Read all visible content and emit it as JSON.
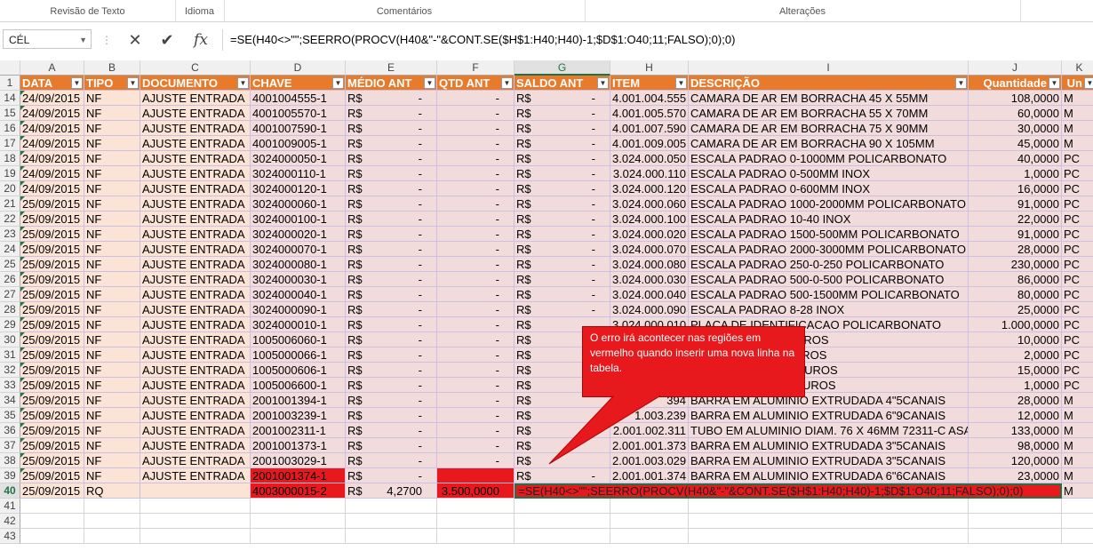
{
  "ribbon": {
    "groups": [
      "Revisão de Texto",
      "Idioma",
      "Comentários",
      "Alterações"
    ]
  },
  "formula_bar": {
    "name_box": "CÉL",
    "formula": "=SE(H40<>\"\";SEERRO(PROCV(H40&\"-\"&CONT.SE($H$1:H40;H40)-1;$D$1:O40;11;FALSO);0);0)",
    "icons": [
      "cancel-x-icon",
      "enter-check-icon",
      "insert-function-fx-icon"
    ],
    "fx_label": "fx"
  },
  "columns": [
    "A",
    "B",
    "C",
    "D",
    "E",
    "F",
    "G",
    "H",
    "I",
    "J",
    "K"
  ],
  "header_row": {
    "row": "1",
    "cells": [
      "DATA",
      "TIPO",
      "DOCUMENTO",
      "CHAVE",
      "MÉDIO ANT",
      "QTD ANT",
      "SALDO ANT",
      "ITEM",
      "DESCRIÇÃO",
      "Quantidade",
      "Un"
    ]
  },
  "rows": [
    {
      "num": "14",
      "data": "24/09/2015",
      "tipo": "NF",
      "doc": "AJUSTE ENTRADA",
      "chave": "4001004555-1",
      "medio": "R$",
      "medio_v": "-",
      "qtd": "-",
      "saldo": "R$",
      "saldo_v": "-",
      "item": "4.001.004.555",
      "desc": "CAMARA DE AR EM BORRACHA 45 X 55MM",
      "quant": "108,0000",
      "un": "M"
    },
    {
      "num": "15",
      "data": "24/09/2015",
      "tipo": "NF",
      "doc": "AJUSTE ENTRADA",
      "chave": "4001005570-1",
      "medio": "R$",
      "medio_v": "-",
      "qtd": "-",
      "saldo": "R$",
      "saldo_v": "-",
      "item": "4.001.005.570",
      "desc": "CAMARA DE AR EM BORRACHA 55 X 70MM",
      "quant": "60,0000",
      "un": "M"
    },
    {
      "num": "16",
      "data": "24/09/2015",
      "tipo": "NF",
      "doc": "AJUSTE ENTRADA",
      "chave": "4001007590-1",
      "medio": "R$",
      "medio_v": "-",
      "qtd": "-",
      "saldo": "R$",
      "saldo_v": "-",
      "item": "4.001.007.590",
      "desc": "CAMARA DE AR EM BORRACHA 75 X 90MM",
      "quant": "30,0000",
      "un": "M"
    },
    {
      "num": "17",
      "data": "24/09/2015",
      "tipo": "NF",
      "doc": "AJUSTE ENTRADA",
      "chave": "4001009005-1",
      "medio": "R$",
      "medio_v": "-",
      "qtd": "-",
      "saldo": "R$",
      "saldo_v": "-",
      "item": "4.001.009.005",
      "desc": "CAMARA DE AR EM BORRACHA 90 X 105MM",
      "quant": "45,0000",
      "un": "M"
    },
    {
      "num": "18",
      "data": "24/09/2015",
      "tipo": "NF",
      "doc": "AJUSTE ENTRADA",
      "chave": "3024000050-1",
      "medio": "R$",
      "medio_v": "-",
      "qtd": "-",
      "saldo": "R$",
      "saldo_v": "-",
      "item": "3.024.000.050",
      "desc": "ESCALA PADRAO 0-1000MM POLICARBONATO",
      "quant": "40,0000",
      "un": "PC"
    },
    {
      "num": "19",
      "data": "24/09/2015",
      "tipo": "NF",
      "doc": "AJUSTE ENTRADA",
      "chave": "3024000110-1",
      "medio": "R$",
      "medio_v": "-",
      "qtd": "-",
      "saldo": "R$",
      "saldo_v": "-",
      "item": "3.024.000.110",
      "desc": "ESCALA PADRAO 0-500MM INOX",
      "quant": "1,0000",
      "un": "PC"
    },
    {
      "num": "20",
      "data": "24/09/2015",
      "tipo": "NF",
      "doc": "AJUSTE ENTRADA",
      "chave": "3024000120-1",
      "medio": "R$",
      "medio_v": "-",
      "qtd": "-",
      "saldo": "R$",
      "saldo_v": "-",
      "item": "3.024.000.120",
      "desc": "ESCALA PADRAO 0-600MM INOX",
      "quant": "16,0000",
      "un": "PC"
    },
    {
      "num": "21",
      "data": "25/09/2015",
      "tipo": "NF",
      "doc": "AJUSTE ENTRADA",
      "chave": "3024000060-1",
      "medio": "R$",
      "medio_v": "-",
      "qtd": "-",
      "saldo": "R$",
      "saldo_v": "-",
      "item": "3.024.000.060",
      "desc": "ESCALA PADRAO 1000-2000MM POLICARBONATO",
      "quant": "91,0000",
      "un": "PC"
    },
    {
      "num": "22",
      "data": "25/09/2015",
      "tipo": "NF",
      "doc": "AJUSTE ENTRADA",
      "chave": "3024000100-1",
      "medio": "R$",
      "medio_v": "-",
      "qtd": "-",
      "saldo": "R$",
      "saldo_v": "-",
      "item": "3.024.000.100",
      "desc": "ESCALA PADRAO 10-40 INOX",
      "quant": "22,0000",
      "un": "PC"
    },
    {
      "num": "23",
      "data": "25/09/2015",
      "tipo": "NF",
      "doc": "AJUSTE ENTRADA",
      "chave": "3024000020-1",
      "medio": "R$",
      "medio_v": "-",
      "qtd": "-",
      "saldo": "R$",
      "saldo_v": "-",
      "item": "3.024.000.020",
      "desc": "ESCALA PADRAO 1500-500MM POLICARBONATO",
      "quant": "91,0000",
      "un": "PC"
    },
    {
      "num": "24",
      "data": "25/09/2015",
      "tipo": "NF",
      "doc": "AJUSTE ENTRADA",
      "chave": "3024000070-1",
      "medio": "R$",
      "medio_v": "-",
      "qtd": "-",
      "saldo": "R$",
      "saldo_v": "-",
      "item": "3.024.000.070",
      "desc": "ESCALA PADRAO 2000-3000MM POLICARBONATO",
      "quant": "28,0000",
      "un": "PC"
    },
    {
      "num": "25",
      "data": "25/09/2015",
      "tipo": "NF",
      "doc": "AJUSTE ENTRADA",
      "chave": "3024000080-1",
      "medio": "R$",
      "medio_v": "-",
      "qtd": "-",
      "saldo": "R$",
      "saldo_v": "-",
      "item": "3.024.000.080",
      "desc": "ESCALA PADRAO 250-0-250 POLICARBONATO",
      "quant": "230,0000",
      "un": "PC"
    },
    {
      "num": "26",
      "data": "25/09/2015",
      "tipo": "NF",
      "doc": "AJUSTE ENTRADA",
      "chave": "3024000030-1",
      "medio": "R$",
      "medio_v": "-",
      "qtd": "-",
      "saldo": "R$",
      "saldo_v": "-",
      "item": "3.024.000.030",
      "desc": "ESCALA PADRAO 500-0-500 POLICARBONATO",
      "quant": "86,0000",
      "un": "PC"
    },
    {
      "num": "27",
      "data": "25/09/2015",
      "tipo": "NF",
      "doc": "AJUSTE ENTRADA",
      "chave": "3024000040-1",
      "medio": "R$",
      "medio_v": "-",
      "qtd": "-",
      "saldo": "R$",
      "saldo_v": "-",
      "item": "3.024.000.040",
      "desc": "ESCALA PADRAO 500-1500MM POLICARBONATO",
      "quant": "80,0000",
      "un": "PC"
    },
    {
      "num": "28",
      "data": "25/09/2015",
      "tipo": "NF",
      "doc": "AJUSTE ENTRADA",
      "chave": "3024000090-1",
      "medio": "R$",
      "medio_v": "-",
      "qtd": "-",
      "saldo": "R$",
      "saldo_v": "-",
      "item": "3.024.000.090",
      "desc": "ESCALA PADRAO 8-28 INOX",
      "quant": "25,0000",
      "un": "PC"
    },
    {
      "num": "29",
      "data": "25/09/2015",
      "tipo": "NF",
      "doc": "AJUSTE ENTRADA",
      "chave": "3024000010-1",
      "medio": "R$",
      "medio_v": "-",
      "qtd": "-",
      "saldo": "R$",
      "saldo_v": "",
      "item": "3.024.000.010",
      "desc": "PLACA DE IDENTIFICACAO POLICARBONATO",
      "quant": "1.000,0000",
      "un": "PC"
    },
    {
      "num": "30",
      "data": "25/09/2015",
      "tipo": "NF",
      "doc": "AJUSTE ENTRADA",
      "chave": "1005006060-1",
      "medio": "R$",
      "medio_v": "-",
      "qtd": "-",
      "saldo": "R$",
      "saldo_v": "",
      "item": "",
      "desc": "TEIRA 6\" LB COM FUROS",
      "quant": "10,0000",
      "un": "PC"
    },
    {
      "num": "31",
      "data": "25/09/2015",
      "tipo": "NF",
      "doc": "AJUSTE ENTRADA",
      "chave": "1005000066-1",
      "medio": "R$",
      "medio_v": "-",
      "qtd": "-",
      "saldo": "R$",
      "saldo_v": "",
      "item": "",
      "desc": "TEIRA 6\" LB SEM FUROS",
      "quant": "2,0000",
      "un": "PC"
    },
    {
      "num": "32",
      "data": "25/09/2015",
      "tipo": "NF",
      "doc": "AJUSTE ENTRADA",
      "chave": "1005000606-1",
      "medio": "R$",
      "medio_v": "-",
      "qtd": "-",
      "saldo": "R$",
      "saldo_v": "",
      "item": "",
      "desc": "TEIRA 6\" LOB COM FUROS",
      "quant": "15,0000",
      "un": "PC"
    },
    {
      "num": "33",
      "data": "25/09/2015",
      "tipo": "NF",
      "doc": "AJUSTE ENTRADA",
      "chave": "1005006600-1",
      "medio": "R$",
      "medio_v": "-",
      "qtd": "-",
      "saldo": "R$",
      "saldo_v": "",
      "item": "",
      "desc": "TEIRA 6\" LOB SEM FUROS",
      "quant": "1,0000",
      "un": "PC"
    },
    {
      "num": "34",
      "data": "25/09/2015",
      "tipo": "NF",
      "doc": "AJUSTE ENTRADA",
      "chave": "2001001394-1",
      "medio": "R$",
      "medio_v": "-",
      "qtd": "-",
      "saldo": "R$",
      "saldo_v": "",
      "item": "394",
      "desc": "BARRA EM ALUMINIO EXTRUDADA 4\"5CANAIS",
      "quant": "28,0000",
      "un": "M"
    },
    {
      "num": "35",
      "data": "25/09/2015",
      "tipo": "NF",
      "doc": "AJUSTE ENTRADA",
      "chave": "2001003239-1",
      "medio": "R$",
      "medio_v": "-",
      "qtd": "-",
      "saldo": "R$",
      "saldo_v": "",
      "item": "1.003.239",
      "desc": "BARRA EM ALUMINIO EXTRUDADA 6\"9CANAIS",
      "quant": "12,0000",
      "un": "M"
    },
    {
      "num": "36",
      "data": "25/09/2015",
      "tipo": "NF",
      "doc": "AJUSTE ENTRADA",
      "chave": "2001002311-1",
      "medio": "R$",
      "medio_v": "-",
      "qtd": "-",
      "saldo": "R$",
      "saldo_v": "",
      "item": "2.001.002.311",
      "desc": "TUBO EM ALUMINIO DIAM. 76 X 46MM 72311-C ASA",
      "quant": "133,0000",
      "un": "M"
    },
    {
      "num": "37",
      "data": "25/09/2015",
      "tipo": "NF",
      "doc": "AJUSTE ENTRADA",
      "chave": "2001001373-1",
      "medio": "R$",
      "medio_v": "-",
      "qtd": "-",
      "saldo": "R$",
      "saldo_v": "",
      "item": "2.001.001.373",
      "desc": "BARRA EM ALUMINIO EXTRUDADA 3\"5CANAIS",
      "quant": "98,0000",
      "un": "M"
    },
    {
      "num": "38",
      "data": "25/09/2015",
      "tipo": "NF",
      "doc": "AJUSTE ENTRADA",
      "chave": "2001003029-1",
      "medio": "R$",
      "medio_v": "-",
      "qtd": "-",
      "saldo": "R$",
      "saldo_v": "",
      "item": "2.001.003.029",
      "desc": "BARRA EM ALUMINIO EXTRUDADA 3\"5CANAIS",
      "quant": "120,0000",
      "un": "M"
    },
    {
      "num": "39",
      "data": "25/09/2015",
      "tipo": "NF",
      "doc": "AJUSTE ENTRADA",
      "chave": "2001001374-1",
      "medio": "R$",
      "medio_v": "-",
      "qtd": "",
      "saldo": "R$",
      "saldo_v": "-",
      "item": "2.001.001.374",
      "desc": "BARRA EM ALUMINIO EXTRUDADA 6\"6CANAIS",
      "quant": "23,0000",
      "un": "M"
    }
  ],
  "row40": {
    "num": "40",
    "data": "25/09/2015",
    "tipo": "RQ",
    "doc": "",
    "chave": "4003000015-2",
    "medio": "R$",
    "medio_v": "4,2700",
    "qtd": "3.500,0000",
    "formula": "=SE(H40<>\"\";SEERRO(PROCV(H40&\"-\"&CONT.SE($H$1:H40;H40)-1;$D$1:O40;11;FALSO);0);0)",
    "un": "M"
  },
  "empty_rows": [
    "41",
    "42",
    "43"
  ],
  "callout": {
    "text": "O erro irá acontecer nas regiões em vermelho quando inserir uma nova linha na tabela."
  },
  "colors": {
    "header_orange": "#e87a2c",
    "fill_peach": "#fbe4d5",
    "fill_pink": "#f2dcdb",
    "error_red": "#e8191d",
    "selection_green": "#217346"
  }
}
